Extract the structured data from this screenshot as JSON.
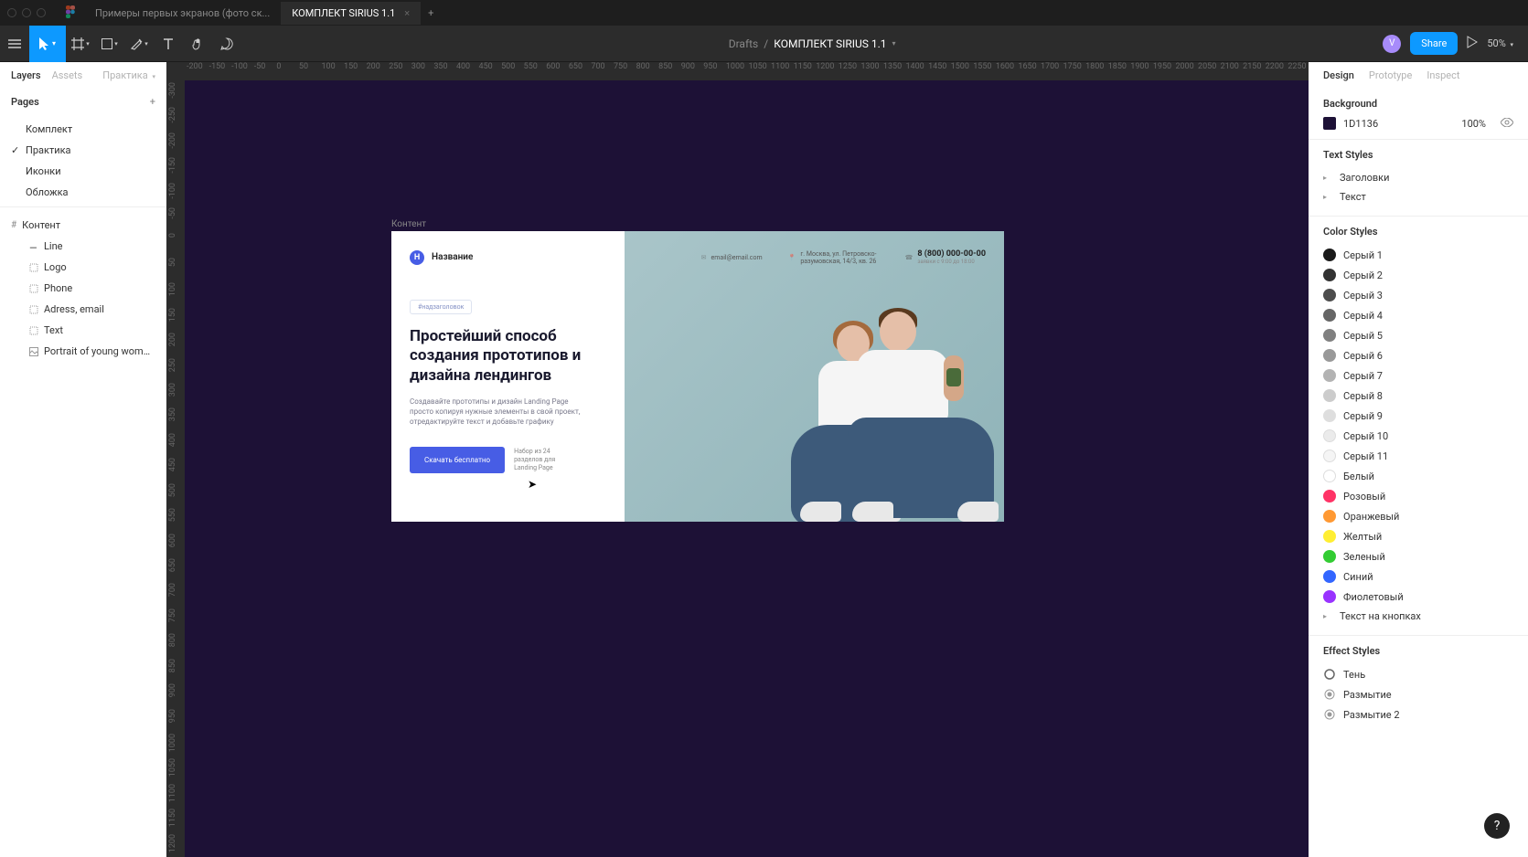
{
  "tabs": {
    "inactive": "Примеры первых экранов (фото ск...",
    "active": "КОМПЛЕКТ SIRIUS 1.1"
  },
  "toolbar": {
    "drafts": "Drafts",
    "separator": "/",
    "filename": "КОМПЛЕКТ SIRIUS 1.1",
    "share": "Share",
    "zoom": "50%",
    "avatar_letter": "V"
  },
  "left_panel": {
    "tabs": {
      "layers": "Layers",
      "assets": "Assets",
      "practice": "Практика"
    },
    "pages_title": "Pages",
    "pages": [
      "Комплект",
      "Практика",
      "Иконки",
      "Обложка"
    ],
    "active_page_index": 1,
    "frame_name": "Контент",
    "layers": [
      "Line",
      "Logo",
      "Phone",
      "Adress, email",
      "Text",
      "Portrait of young woman tellin..."
    ]
  },
  "canvas": {
    "ruler_h": [
      "-200",
      "-150",
      "-100",
      "-50",
      "0",
      "50",
      "100",
      "150",
      "200",
      "250",
      "300",
      "350",
      "400",
      "450",
      "500",
      "550",
      "600",
      "650",
      "700",
      "750",
      "800",
      "850",
      "900",
      "950",
      "1000",
      "1050",
      "1100",
      "1150",
      "1200",
      "1250",
      "1300",
      "1350",
      "1400",
      "1450",
      "1500",
      "1550",
      "1600",
      "1650",
      "1700",
      "1750",
      "1800",
      "1850",
      "1900",
      "1950",
      "2000",
      "2050",
      "2100",
      "2150",
      "2200",
      "2250"
    ],
    "ruler_v": [
      "-300",
      "-250",
      "-200",
      "-150",
      "-100",
      "-50",
      "0",
      "50",
      "100",
      "150",
      "200",
      "250",
      "300",
      "350",
      "400",
      "450",
      "500",
      "550",
      "600",
      "650",
      "700",
      "750",
      "800",
      "850",
      "900",
      "950",
      "1000",
      "1050",
      "1100",
      "1150",
      "1200"
    ],
    "frame_label": "Контент"
  },
  "artboard": {
    "logo_letter": "Н",
    "brand": "Название",
    "email": "email@email.com",
    "address": "г. Москва, ул. Петровско-разумовская, 14/3, кв. 26",
    "phone": "8 (800) 000-00-00",
    "phone_sub": "заявки с 9:00 до 18:00",
    "badge": "#надзаголовок",
    "title": "Простейший способ создания прототипов и дизайна лендингов",
    "subtitle": "Создавайте прототипы и дизайн Landing Page просто копируя нужные элементы в свой проект, отредактируйте текст и добавьте графику",
    "cta": "Скачать бесплатно",
    "cta_sub": "Набор из 24 разделов для Landing Page"
  },
  "right_panel": {
    "tabs": {
      "design": "Design",
      "prototype": "Prototype",
      "inspect": "Inspect"
    },
    "background": {
      "title": "Background",
      "hex": "1D1136",
      "opacity": "100%"
    },
    "text_styles": {
      "title": "Text Styles",
      "items": [
        "Заголовки",
        "Текст"
      ]
    },
    "color_styles": {
      "title": "Color Styles",
      "items": [
        {
          "name": "Серый 1",
          "color": "#1a1a1a"
        },
        {
          "name": "Серый 2",
          "color": "#333333"
        },
        {
          "name": "Серый 3",
          "color": "#4d4d4d"
        },
        {
          "name": "Серый 4",
          "color": "#666666"
        },
        {
          "name": "Серый 5",
          "color": "#808080"
        },
        {
          "name": "Серый 6",
          "color": "#999999"
        },
        {
          "name": "Серый 7",
          "color": "#b3b3b3"
        },
        {
          "name": "Серый 8",
          "color": "#cccccc"
        },
        {
          "name": "Серый 9",
          "color": "#dedede"
        },
        {
          "name": "Серый 10",
          "color": "#ebebeb"
        },
        {
          "name": "Серый 11",
          "color": "#f5f5f5"
        },
        {
          "name": "Белый",
          "color": "#ffffff"
        },
        {
          "name": "Розовый",
          "color": "#ff3366"
        },
        {
          "name": "Оранжевый",
          "color": "#ff9933"
        },
        {
          "name": "Желтый",
          "color": "#ffee33"
        },
        {
          "name": "Зеленый",
          "color": "#33cc33"
        },
        {
          "name": "Синий",
          "color": "#3366ff"
        },
        {
          "name": "Фиолетовый",
          "color": "#9933ff"
        }
      ],
      "text_on_buttons": "Текст на кнопках"
    },
    "effect_styles": {
      "title": "Effect Styles",
      "items": [
        "Тень",
        "Размытие",
        "Размытие 2"
      ]
    }
  }
}
